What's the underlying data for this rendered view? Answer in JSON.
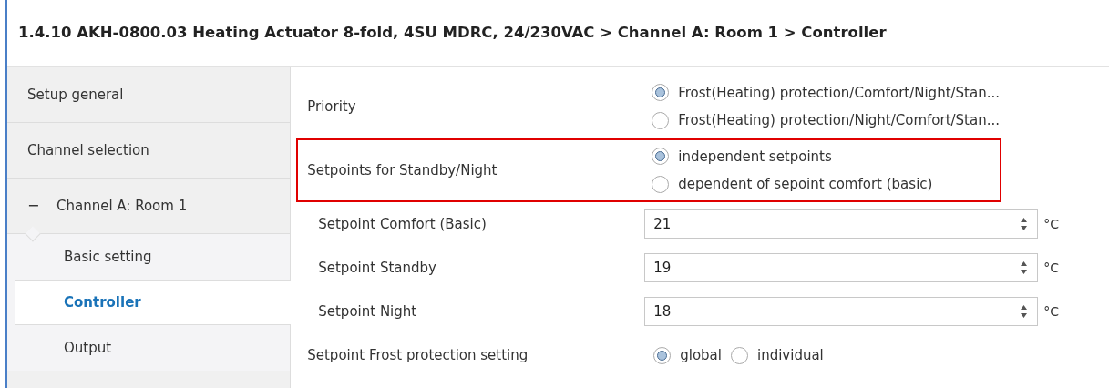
{
  "window": {
    "title": "1.4.10 AKH-0800.03 Heating Actuator 8-fold, 4SU MDRC, 24/230VAC > Channel A: Room 1 > Controller"
  },
  "sidebar": {
    "items": [
      {
        "label": "Setup general",
        "selected": false
      },
      {
        "label": "Channel selection",
        "selected": false
      },
      {
        "label": "Channel A: Room 1",
        "selected": false,
        "toggle": "−",
        "children": [
          {
            "label": "Basic setting",
            "selected": false
          },
          {
            "label": "Controller",
            "selected": true
          },
          {
            "label": "Output",
            "selected": false
          }
        ]
      }
    ]
  },
  "parameters": [
    {
      "kind": "radio",
      "label": "Priority",
      "highlighted": false,
      "options": [
        {
          "label": "Frost(Heating) protection/Comfort/Night/Stan...",
          "selected": true
        },
        {
          "label": "Frost(Heating) protection/Night/Comfort/Stan...",
          "selected": false
        }
      ]
    },
    {
      "kind": "radio",
      "label": "Setpoints for Standby/Night",
      "highlighted": true,
      "options": [
        {
          "label": "independent setpoints",
          "selected": true
        },
        {
          "label": "dependent of sepoint comfort (basic)",
          "selected": false
        }
      ]
    },
    {
      "kind": "spin",
      "label": "Setpoint Comfort (Basic)",
      "value": "21",
      "unit": "°C"
    },
    {
      "kind": "spin",
      "label": "Setpoint Standby",
      "value": "19",
      "unit": "°C"
    },
    {
      "kind": "spin",
      "label": "Setpoint Night",
      "value": "18",
      "unit": "°C"
    },
    {
      "kind": "radio-inline",
      "label": "Setpoint Frost protection setting",
      "options": [
        {
          "label": "global",
          "selected": true
        },
        {
          "label": "individual",
          "selected": false
        }
      ]
    }
  ]
}
